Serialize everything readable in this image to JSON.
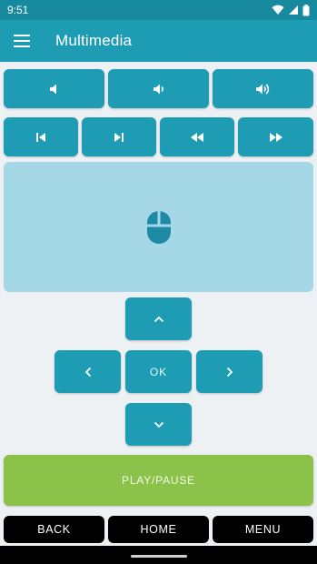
{
  "status_bar": {
    "time": "9:51"
  },
  "app_bar": {
    "title": "Multimedia"
  },
  "volume": [
    "mute",
    "volume-down",
    "volume-up"
  ],
  "media": [
    "previous",
    "next",
    "rewind",
    "fast-forward"
  ],
  "dpad": {
    "ok_label": "OK"
  },
  "play_pause_label": "PLAY/PAUSE",
  "bottom": {
    "back": "BACK",
    "home": "HOME",
    "menu": "MENU"
  },
  "colors": {
    "primary": "#1e9cb4",
    "primary_dark": "#16899f",
    "touchpad": "#a5d8e6",
    "play": "#8bc34a",
    "background": "#eef1f4"
  }
}
